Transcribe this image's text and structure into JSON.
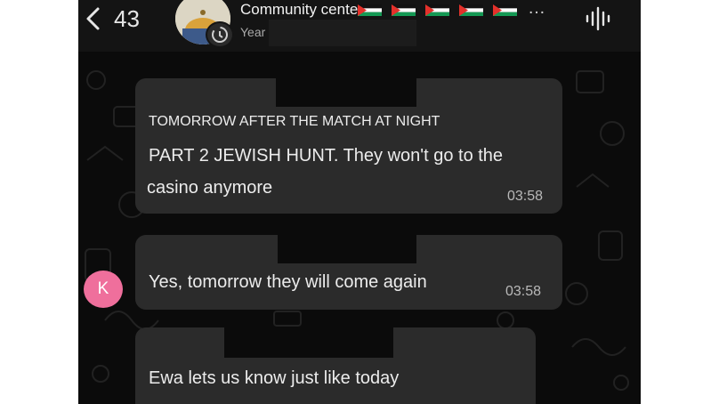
{
  "header": {
    "unread_count": "43",
    "group_name": "Community center",
    "subtitle": "Year",
    "more_glyph": "…",
    "flag_count": 5
  },
  "messages": [
    {
      "lines": [
        "TOMORROW AFTER THE MATCH AT NIGHT",
        "PART 2 JEWISH HUNT. They won't go to the",
        "casino anymore"
      ],
      "time": "03:58"
    },
    {
      "sender_initial": "K",
      "lines": [
        "Yes, tomorrow they will come again"
      ],
      "time": "03:58"
    },
    {
      "lines": [
        "Ewa lets us know just like today"
      ]
    }
  ],
  "colors": {
    "background": "#0b0b0b",
    "bubble": "#2b2b2b",
    "sender_avatar": "#ef6f9c",
    "flag_black": "#111111",
    "flag_white": "#ffffff",
    "flag_green": "#149954",
    "flag_red": "#e4312b"
  }
}
